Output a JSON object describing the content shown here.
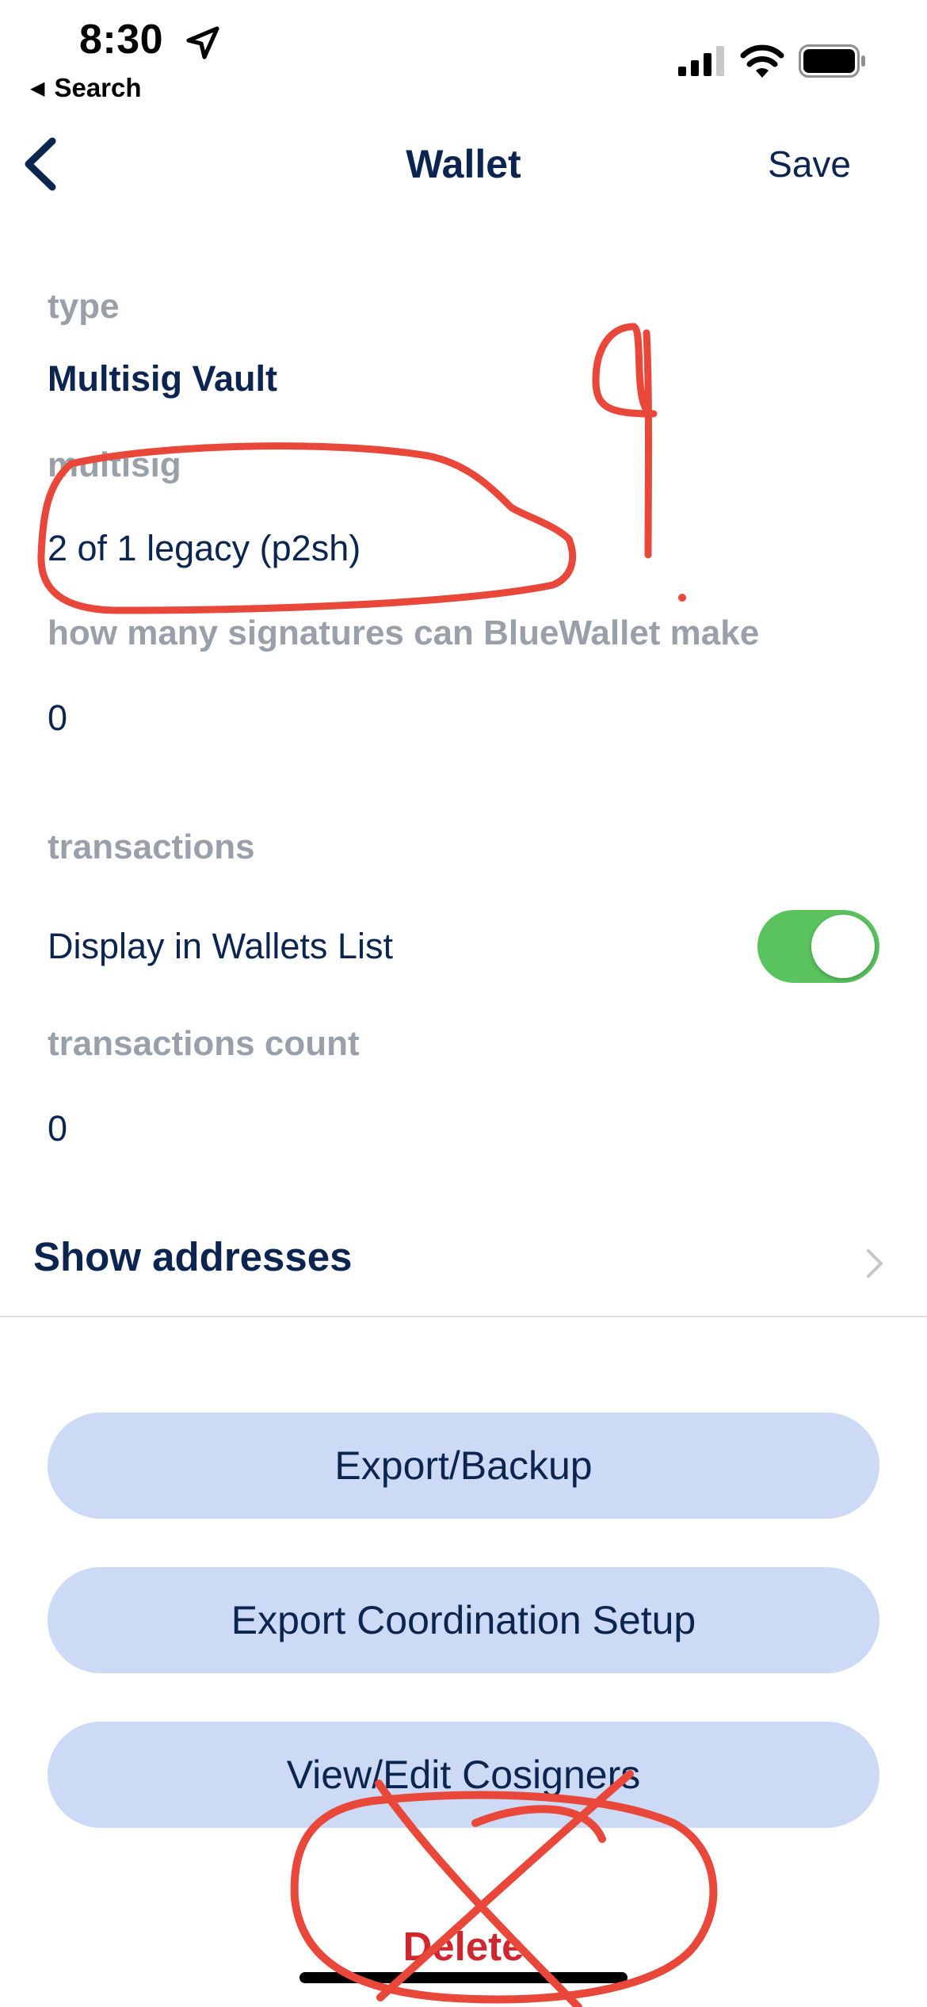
{
  "status_bar": {
    "time": "8:30",
    "back_app_label": "Search",
    "icons": [
      "location-arrow-icon",
      "cellular-signal-icon",
      "wifi-icon",
      "battery-icon"
    ]
  },
  "nav": {
    "title": "Wallet",
    "save_label": "Save",
    "back_icon": "chevron-left-icon"
  },
  "fields": {
    "type_label": "type",
    "type_value": "Multisig Vault",
    "multisig_label": "multisig",
    "multisig_value": "2 of 1 legacy (p2sh)",
    "signatures_label": "how many signatures can BlueWallet make",
    "signatures_value": "0",
    "transactions_label": "transactions",
    "display_in_list_label": "Display in Wallets List",
    "display_in_list_enabled": true,
    "transactions_count_label": "transactions count",
    "transactions_count_value": "0"
  },
  "show_addresses": {
    "label": "Show addresses",
    "icon": "chevron-right-icon"
  },
  "buttons": {
    "export_backup": "Export/Backup",
    "export_coordination": "Export Coordination Setup",
    "view_edit_cosigners": "View/Edit Cosigners",
    "delete": "Delete"
  },
  "annotation": {
    "handwritten_number": "9"
  },
  "colors": {
    "primary_text": "#0c2550",
    "label_gray": "#9aa0aa",
    "button_bg": "#ccdaf5",
    "toggle_on": "#5ac35e",
    "delete_red": "#d0262d",
    "annotation_red": "#e8473a"
  }
}
